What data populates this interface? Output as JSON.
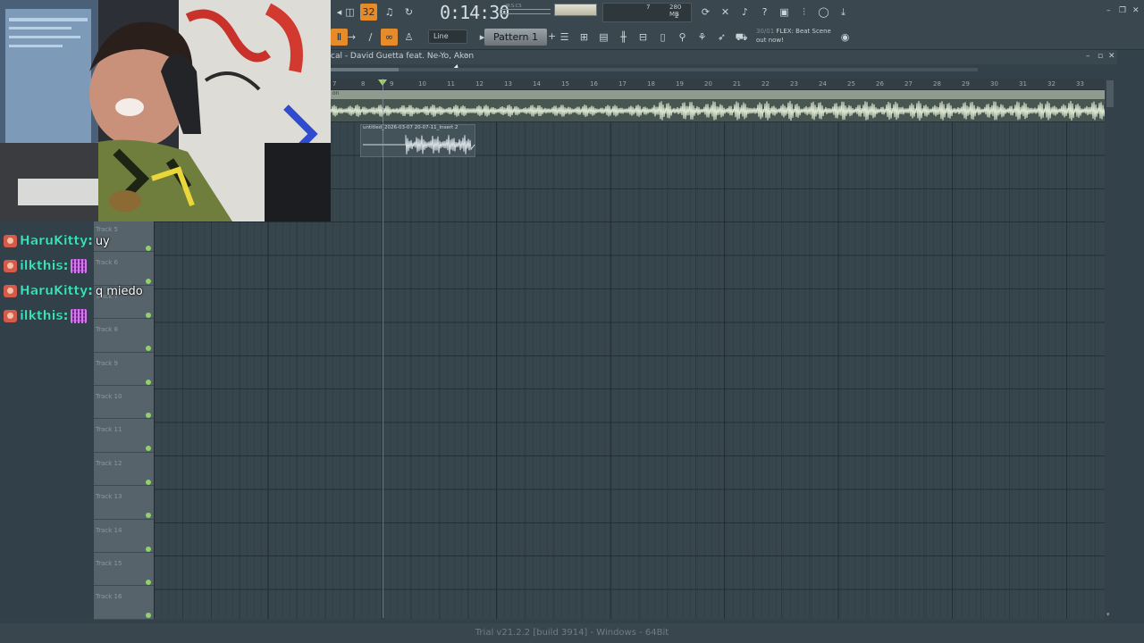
{
  "toolbar": {
    "time": "0:14:30",
    "time_unit_label": "M:S:CS",
    "cpu_value": "7",
    "mem_value": "280 MB",
    "poly_value": "2",
    "snap_label": "Line",
    "pattern_label": "Pattern 1",
    "pattern_add": "+",
    "news_date": "30/01",
    "news_line1": "FLEX: Beat Scene",
    "news_line2": "out now!",
    "accent_color": "#e58b2a"
  },
  "playlist": {
    "title": "cal - David Guetta feat. Ne-Yo, Akon",
    "title_arrow": "›",
    "ruler_numbers": [
      "7",
      "8",
      "9",
      "10",
      "11",
      "12",
      "13",
      "14",
      "15",
      "16",
      "17",
      "18",
      "19",
      "20",
      "21",
      "22",
      "23",
      "24",
      "25",
      "26",
      "27",
      "28",
      "29",
      "30",
      "31",
      "32",
      "33"
    ],
    "timesig_label": "on",
    "clip_title": "untitled_2026-03-07 20-07-11_Insert 2",
    "tracks": [
      "Track 5",
      "Track 6",
      "Track 7",
      "Track 8",
      "Track 9",
      "Track 10",
      "Track 11",
      "Track 12",
      "Track 13",
      "Track 14",
      "Track 15",
      "Track 16"
    ]
  },
  "chat": {
    "messages": [
      {
        "user": "HaruKitty",
        "text": "uy",
        "emote": false
      },
      {
        "user": "ilkthis",
        "text": "",
        "emote": true
      },
      {
        "user": "HaruKitty",
        "text": "q miedo",
        "emote": false
      },
      {
        "user": "ilkthis",
        "text": "",
        "emote": true
      }
    ]
  },
  "status_bar": {
    "text": "Trial v21.2.2 [build 3914] - Windows - 64Bit"
  }
}
